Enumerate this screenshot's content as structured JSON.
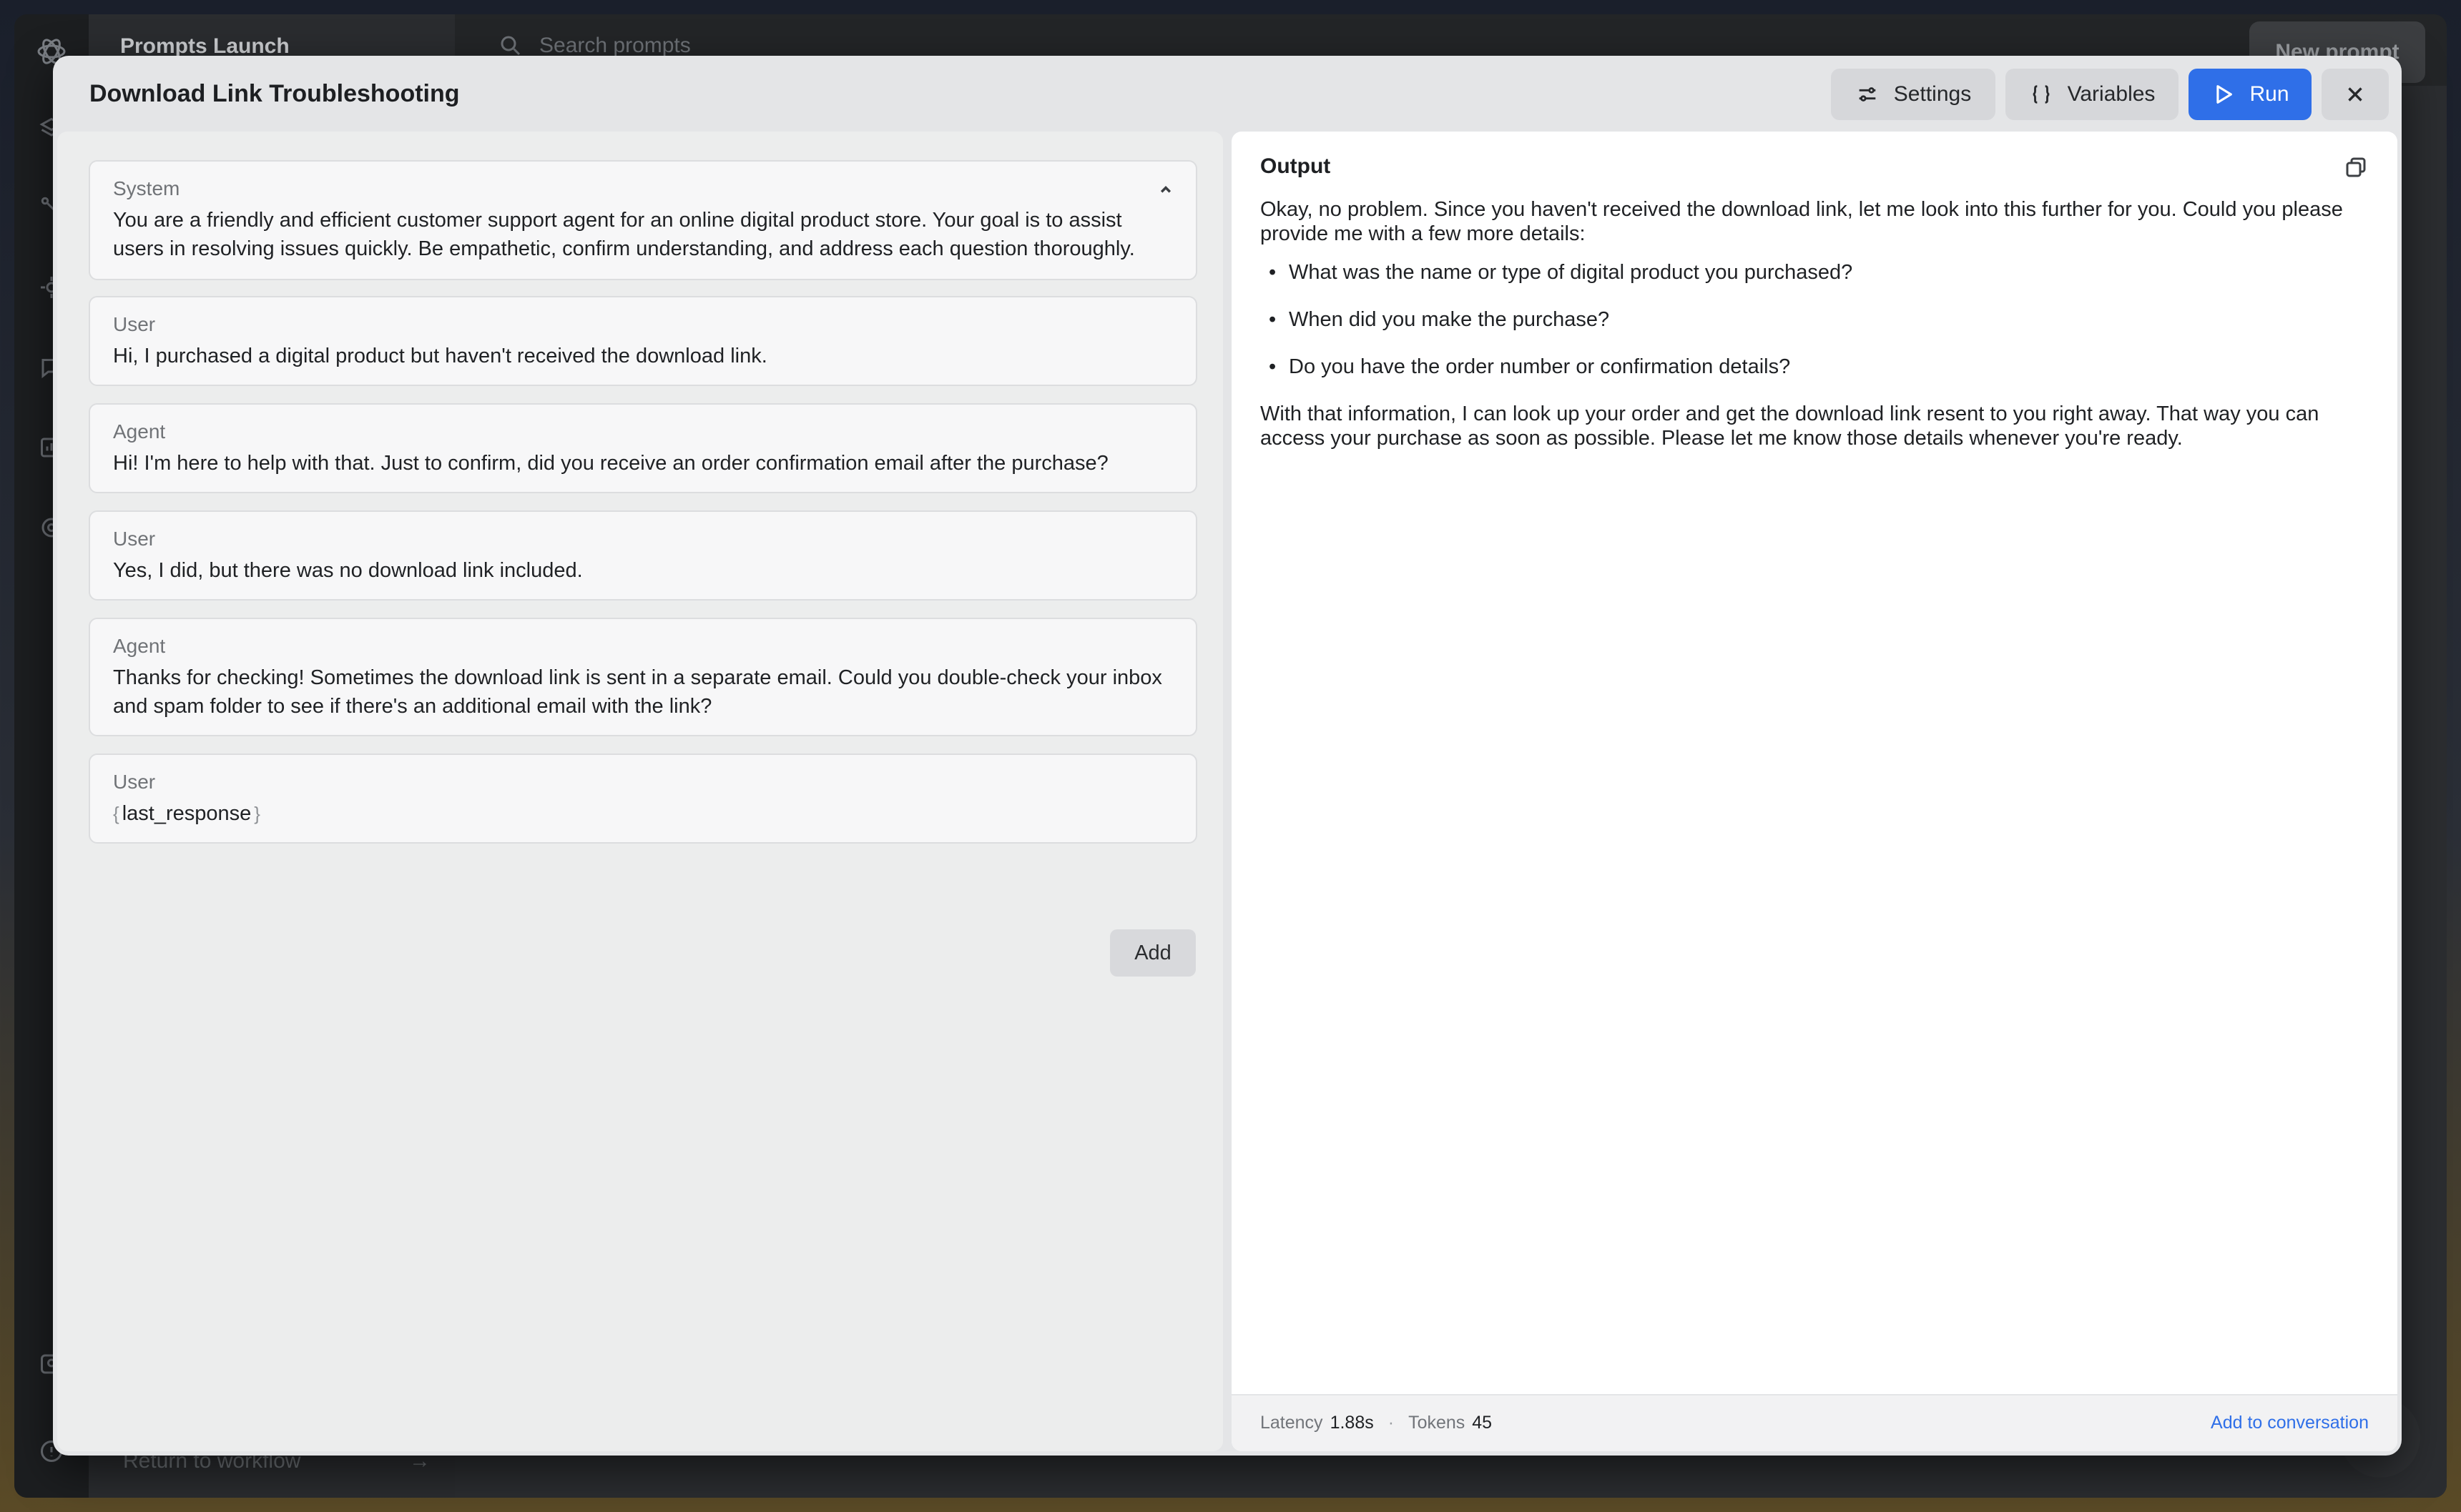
{
  "background_app": {
    "sidebar_title": "Prompts Launch",
    "search_placeholder": "Search prompts",
    "new_prompt_label": "New prompt",
    "return_label": "Return to workflow"
  },
  "modal": {
    "title": "Download Link Troubleshooting",
    "buttons": {
      "settings": "Settings",
      "variables": "Variables",
      "run": "Run"
    }
  },
  "messages": [
    {
      "role": "System",
      "text": "You are a friendly and efficient customer support agent for an online digital product store. Your goal is to assist users in resolving issues quickly. Be empathetic, confirm understanding, and address each question thoroughly."
    },
    {
      "role": "User",
      "text": "Hi, I purchased a digital product but haven't received the download link."
    },
    {
      "role": "Agent",
      "text": "Hi! I'm here to help with that. Just to confirm, did you receive an order confirmation email after the purchase?"
    },
    {
      "role": "User",
      "text": "Yes, I did, but there was no download link included."
    },
    {
      "role": "Agent",
      "text": "Thanks for checking! Sometimes the download link is sent in a separate email. Could you double-check your inbox and spam folder to see if there's an additional email with the link?"
    },
    {
      "role": "User",
      "variable": "last_response"
    }
  ],
  "add_label": "Add",
  "output": {
    "label": "Output",
    "intro": "Okay, no problem. Since you haven't received the download link, let me look into this further for you. Could you please provide me with a few more details:",
    "bullets": [
      "What was the name or type of digital product you purchased?",
      "When did you make the purchase?",
      "Do you have the order number or confirmation details?"
    ],
    "closing": "With that information, I can look up your order and get the download link resent to you right away. That way you can access your purchase as soon as possible. Please let me know those details whenever you're ready."
  },
  "footer": {
    "latency_label": "Latency",
    "latency_value": "1.88s",
    "tokens_label": "Tokens",
    "tokens_value": "45",
    "add_to_conversation": "Add to conversation"
  },
  "colors": {
    "accent": "#2f6fe8",
    "modal_bg": "#e4e5e7",
    "card_bg": "#f7f7f8"
  }
}
